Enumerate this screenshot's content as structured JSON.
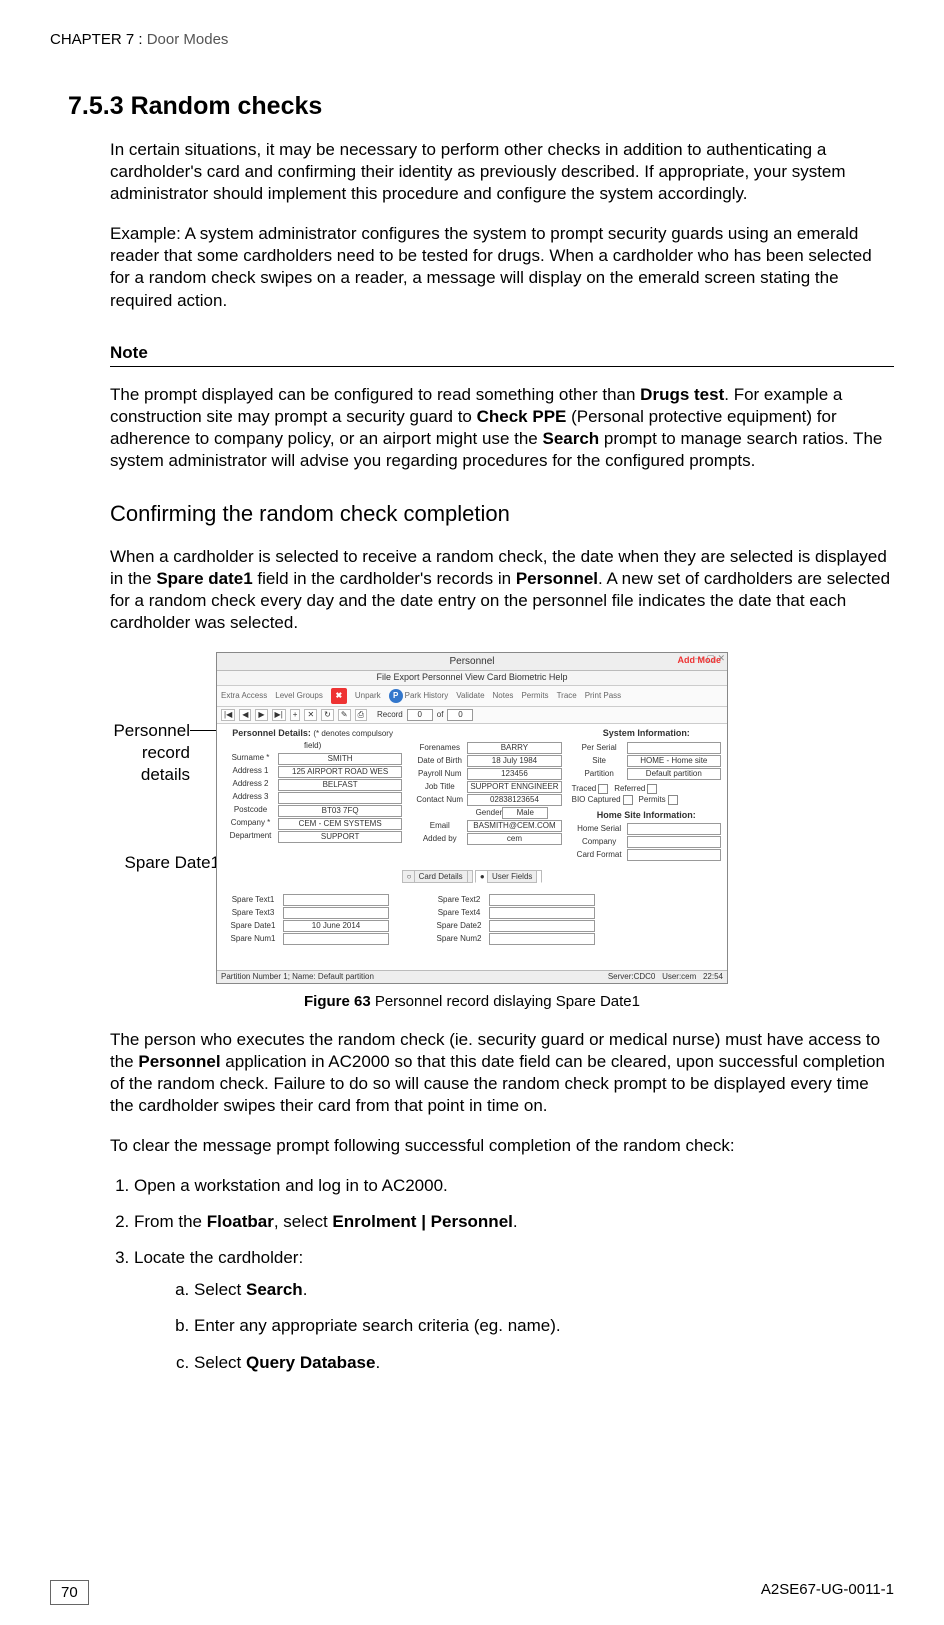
{
  "chapter": {
    "num": "CHAPTER 7 :",
    "title": "Door Modes"
  },
  "section": {
    "num": "7.5.3",
    "title": "Random checks"
  },
  "para1": "In certain situations, it may be necessary to perform other checks in addition to authenticating a cardholder's card and confirming their identity as previously described. If appropriate, your system administrator should implement this procedure and configure the system accordingly.",
  "para2": "Example: A system administrator configures the system to prompt security guards using an emerald reader that some cardholders need to be tested for drugs. When a cardholder who has been selected for a random check swipes on a reader, a message will display on the emerald screen stating the required action.",
  "note": {
    "head": "Note",
    "t1": "The prompt displayed can be configured to read something other than ",
    "b1": "Drugs test",
    "t2": ". For example a construction site may prompt a security guard to ",
    "b2": "Check PPE",
    "t3": " (Personal protective equipment) for adherence to company policy, or an airport might use the ",
    "b3": "Search",
    "t4": " prompt to manage search ratios. The system administrator will advise you regarding procedures for the configured prompts."
  },
  "sub": "Confirming the random check completion",
  "para3a": "When a cardholder is selected to receive a random check, the date when they are selected is displayed in the ",
  "para3b": "Spare date1",
  "para3c": " field in the cardholder's records in ",
  "para3d": "Personnel",
  "para3e": ". A new set of cardholders are selected for a random check every day and the date entry on the personnel file indicates the date that each cardholder was selected.",
  "callouts": {
    "c1a": "Personnel",
    "c1b": "record",
    "c1c": "details",
    "c2": "Spare Date1"
  },
  "app": {
    "title": "Personnel",
    "menu": "File   Export   Personnel   View   Card   Biometric   Help",
    "tool": {
      "extra": "Extra Access",
      "level": "Level Groups",
      "unpark": "Unpark",
      "park": "Park History",
      "validate": "Validate",
      "notes": "Notes",
      "permits": "Permits",
      "trace": "Trace",
      "printpass": "Print Pass"
    },
    "tb2": {
      "record": "Record",
      "of": "of",
      "n0": "0"
    },
    "addmode": "Add Mode",
    "pd": {
      "head": "Personnel Details:",
      "req": "(* denotes compulsory field)",
      "l": {
        "surname": "Surname *",
        "addr1": "Address 1",
        "addr2": "Address 2",
        "addr3": "Address 3",
        "postcode": "Postcode",
        "company": "Company *",
        "dept": "Department"
      },
      "v": {
        "surname": "SMITH",
        "addr1": "125 AIRPORT ROAD WES",
        "addr2": "BELFAST",
        "addr3": "",
        "postcode": "BT03 7FQ",
        "company": "CEM - CEM SYSTEMS",
        "dept": "SUPPORT"
      }
    },
    "mid": {
      "l": {
        "fore": "Forenames",
        "dob": "Date of Birth",
        "payroll": "Payroll Num",
        "job": "Job Title",
        "contact": "Contact Num",
        "gender": "Gender",
        "email": "Email",
        "added": "Added by"
      },
      "v": {
        "fore": "BARRY",
        "dob": "18 July 1984",
        "payroll": "123456",
        "job": "SUPPORT ENNGINEER",
        "contact": "02838123654",
        "gender": "Male",
        "email": "BASMITH@CEM.COM",
        "added": "cem"
      }
    },
    "sys": {
      "head": "System Information:",
      "l": {
        "serial": "Per Serial",
        "site": "Site",
        "part": "Partition",
        "traced": "Traced",
        "referred": "Referred",
        "bio": "BIO Captured",
        "permits": "Permits",
        "hsi": "Home Site Information:",
        "hserial": "Home Serial",
        "company": "Company",
        "cfmt": "Card Format"
      },
      "v": {
        "site": "HOME - Home site",
        "part": "Default partition"
      }
    },
    "tabs": {
      "card": "Card Details",
      "user": "User Fields"
    },
    "spare": {
      "l": {
        "st1": "Spare Text1",
        "st2": "Spare Text2",
        "st3": "Spare Text3",
        "st4": "Spare Text4",
        "sd1": "Spare Date1",
        "sd2": "Spare Date2",
        "sn1": "Spare Num1",
        "sn2": "Spare Num2"
      },
      "v": {
        "sd1": "10 June 2014"
      }
    },
    "status": {
      "left": "Partition Number 1;  Name: Default partition",
      "mid": "Server:CDC0",
      "user": "User:cem",
      "time": "22:54"
    }
  },
  "figcap": {
    "b": "Figure 63",
    "t": " Personnel record dislaying Spare Date1"
  },
  "para4a": "The person who executes the random check (ie. security guard or medical nurse) must have access to the ",
  "para4b": "Personnel",
  "para4c": " application in AC2000 so that this date field can be cleared, upon successful completion of the random check. Failure to do so will cause the random check prompt to be displayed every time the cardholder swipes their card from that point in time on.",
  "para5": "To clear the message prompt following successful completion of the random check:",
  "steps": {
    "s1": "Open a workstation and log in to AC2000.",
    "s2a": "From the ",
    "s2b": "Floatbar",
    "s2c": ", select ",
    "s2d": "Enrolment | Personnel",
    "s2e": ".",
    "s3": "Locate the cardholder:",
    "a1a": "Select ",
    "a1b": "Search",
    "a1c": ".",
    "a2": "Enter any appropriate search criteria (eg. name).",
    "a3a": "Select ",
    "a3b": "Query Database",
    "a3c": "."
  },
  "footer": {
    "page": "70",
    "doc": "A2SE67-UG-0011-1"
  }
}
